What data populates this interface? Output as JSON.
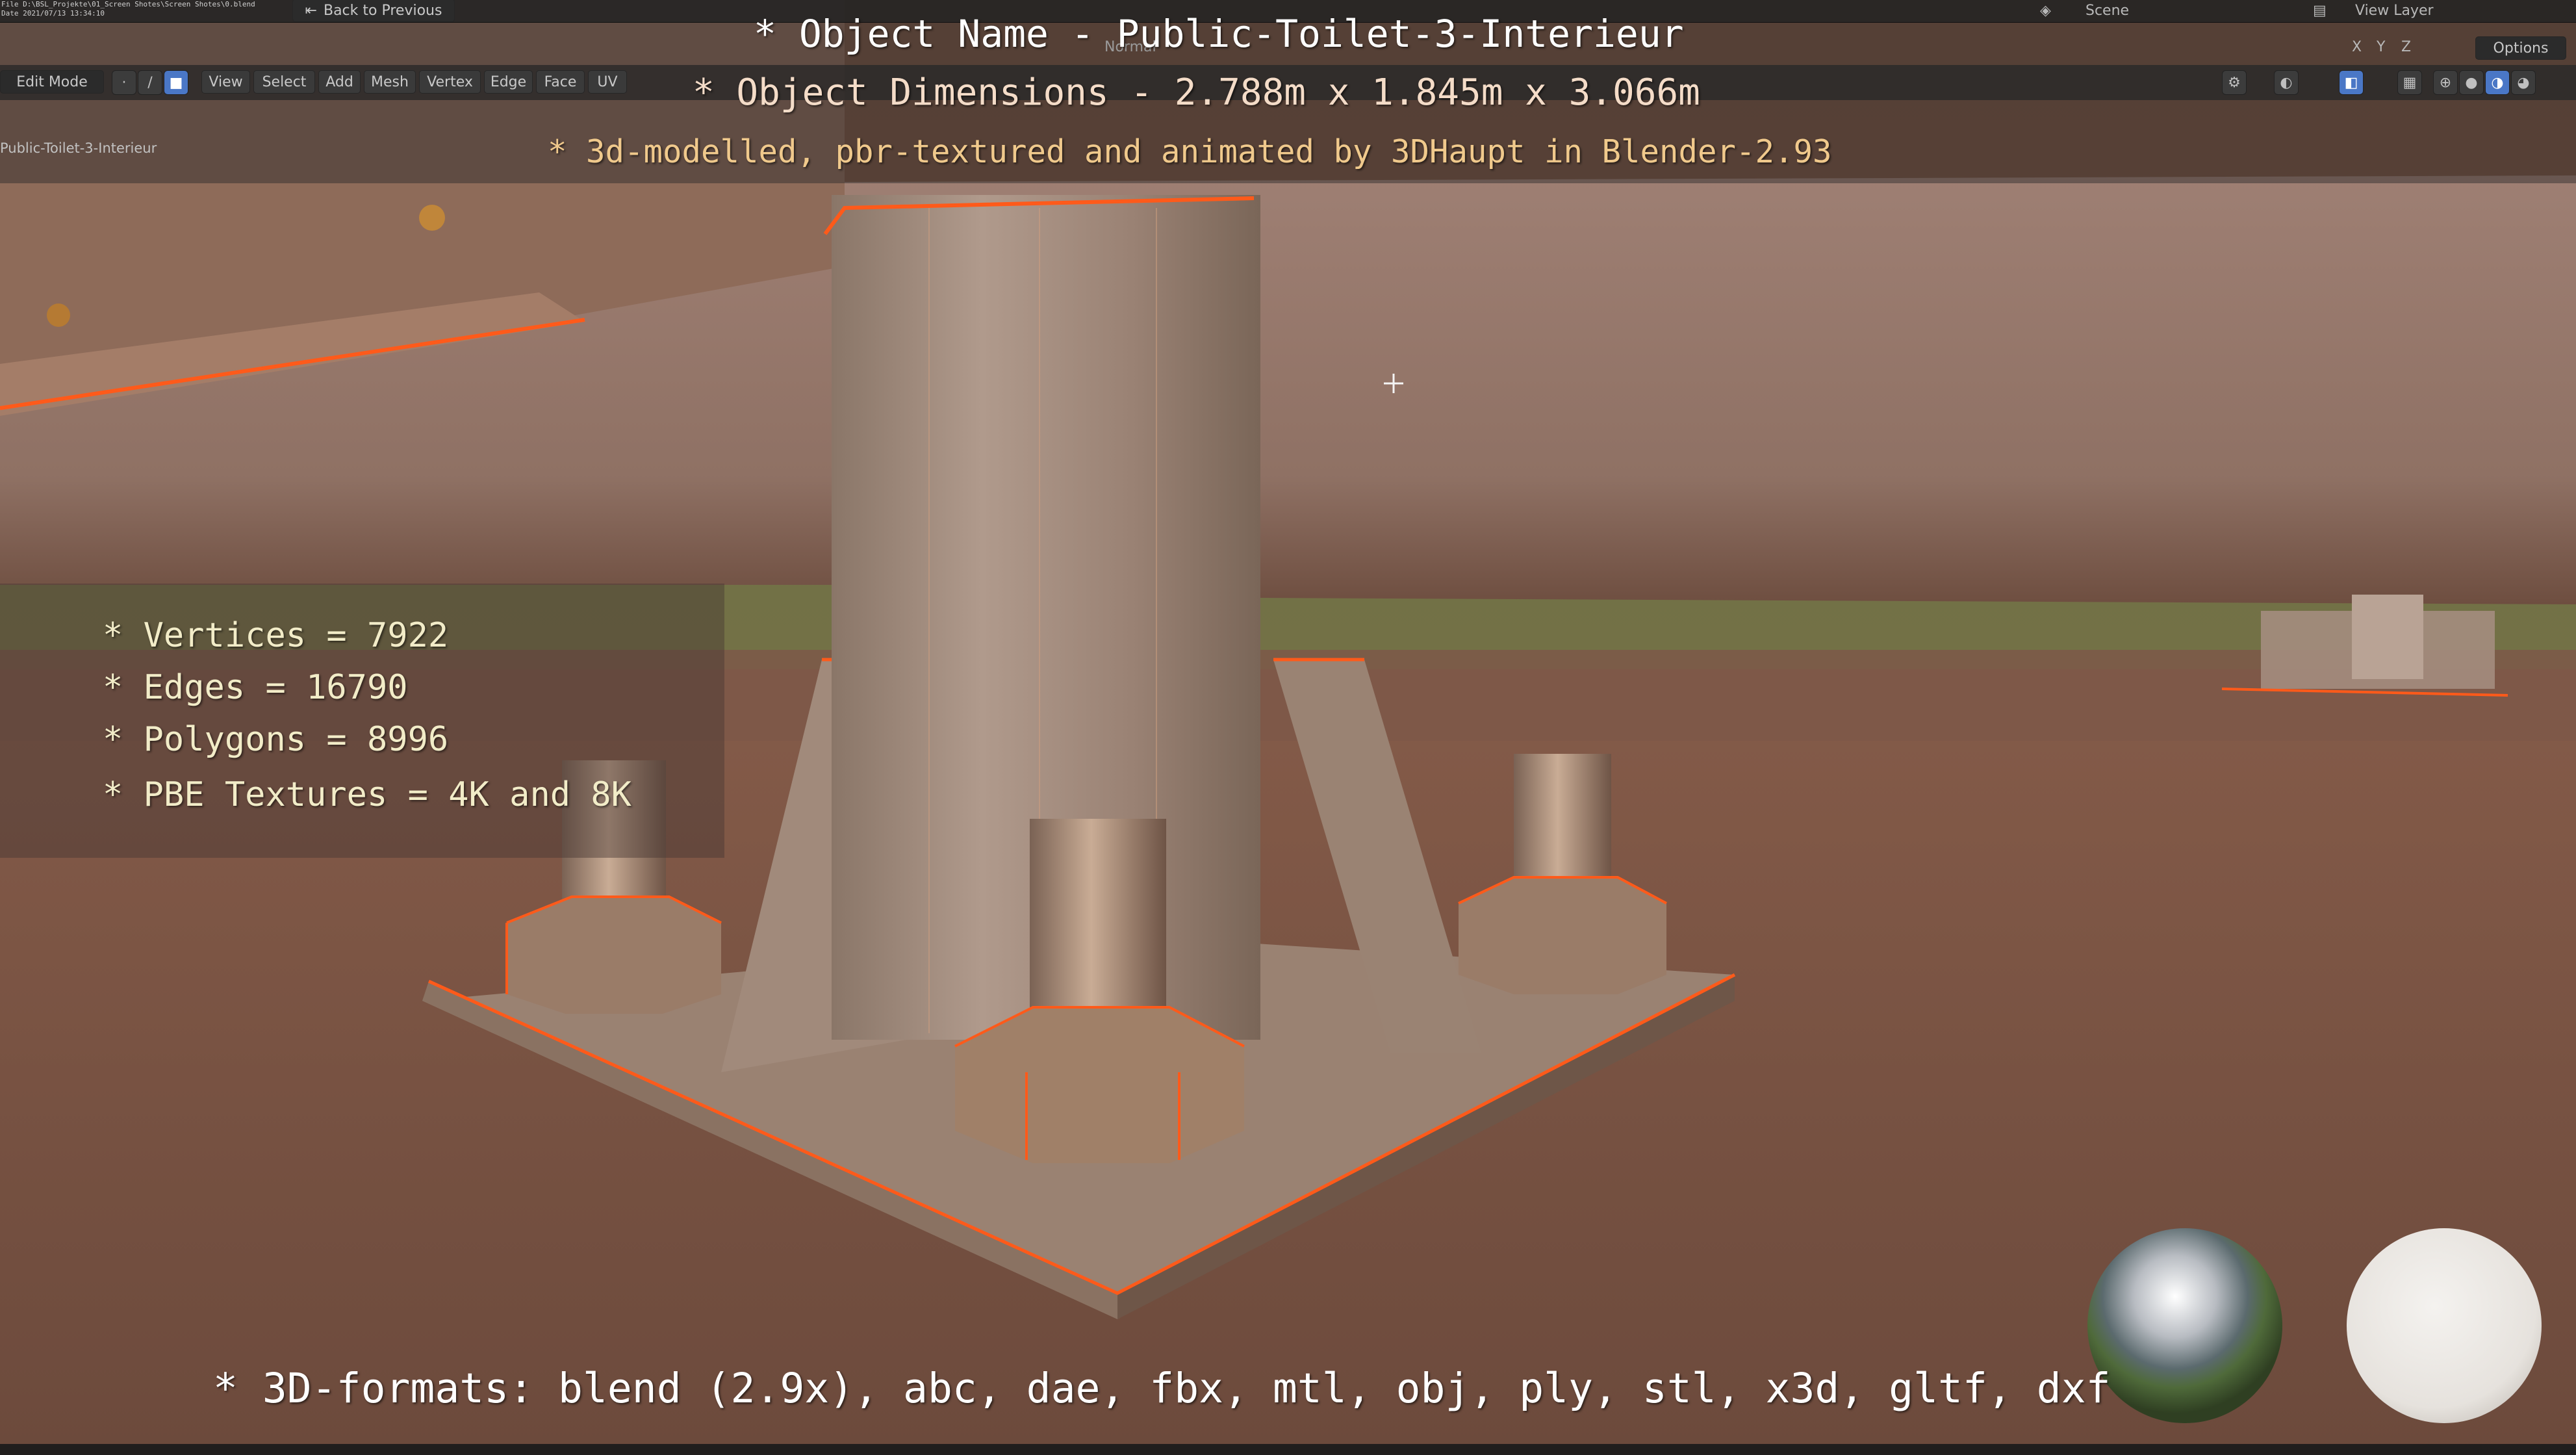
{
  "overlay": {
    "title": "* Object Name - Public-Toilet-3-Interieur",
    "dimensions": "* Object Dimensions -  2.788m x 1.845m x 3.066m",
    "credit": "* 3d-modelled, pbr-textured and animated by 3DHaupt in Blender-2.93",
    "formats": "* 3D-formats: blend (2.9x), abc, dae, fbx, mtl, obj, ply, stl, x3d, gltf, dxf"
  },
  "stats": {
    "vertices": "* Vertices = 7922",
    "edges": "* Edges = 16790",
    "polygons": "* Polygons = 8996",
    "textures": "* PBE Textures = 4K and 8K"
  },
  "blender": {
    "back_button": "Back to Previous",
    "scene_label": "Scene",
    "view_layer_label": "View Layer",
    "mode_select": "Edit Mode",
    "menu": [
      "View",
      "Select",
      "Add",
      "Mesh",
      "Vertex",
      "Edge",
      "Face",
      "UV"
    ],
    "orientation": "Normal",
    "options_label": "Options",
    "object_label": "Public-Toilet-3-Interieur",
    "axis_labels": [
      "X",
      "Y",
      "Z"
    ]
  },
  "colors": {
    "edit_wire": "#ff5a1a",
    "overlay_accent": "#f0c98c",
    "stats_text": "#f2ecc8"
  },
  "icons": {
    "cursor": "3d-cursor-crosshair",
    "matcap_chrome": "hdri-preview-chrome-sphere",
    "matcap_diffuse": "hdri-preview-diffuse-sphere"
  }
}
